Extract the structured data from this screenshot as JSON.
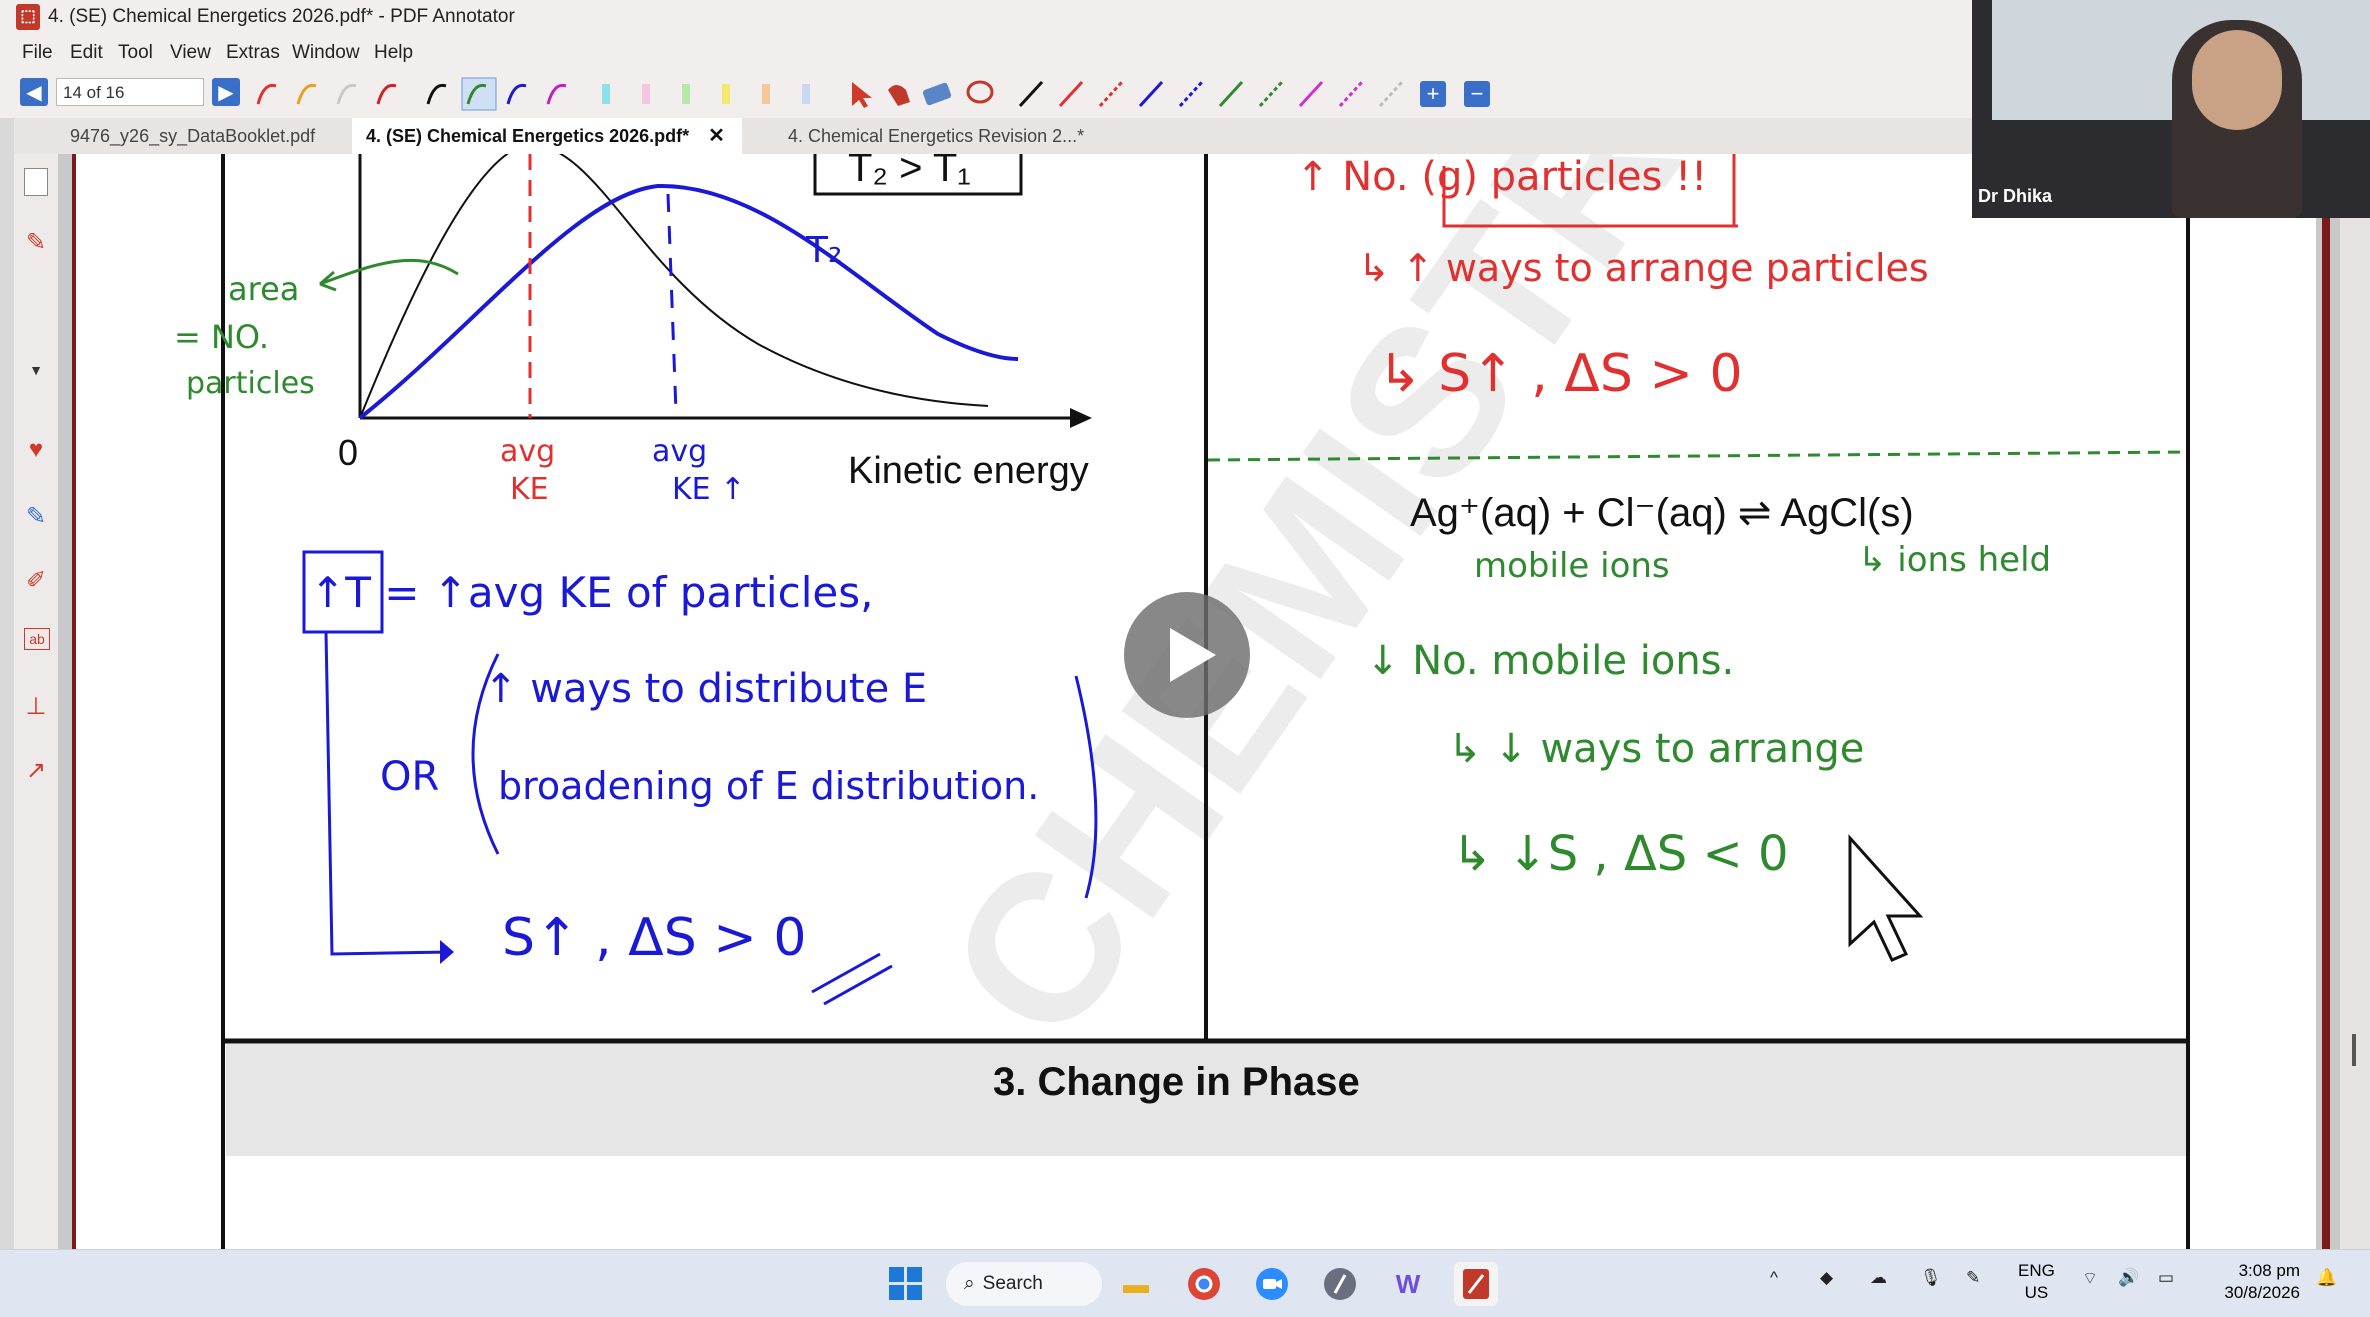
{
  "window": {
    "title": "4. (SE) Chemical Energetics 2026.pdf* - PDF Annotator",
    "app_icon": "pdf-annotator-icon"
  },
  "menu": [
    "File",
    "Edit",
    "Tool",
    "View",
    "Extras",
    "Window",
    "Help"
  ],
  "toolbar": {
    "page_indicator": "14 of 16",
    "prev_icon": "prev-page-icon",
    "next_icon": "next-page-icon"
  },
  "tabs": [
    {
      "label": "9476_y26_sy_DataBooklet.pdf",
      "active": false
    },
    {
      "label": "4. (SE) Chemical Energetics 2026.pdf*",
      "active": true,
      "close": "✕"
    },
    {
      "label": "4. Chemical Energetics Revision 2...*",
      "active": false
    }
  ],
  "document": {
    "box_label_partial": "T₂ > T₁",
    "origin_label": "0",
    "x_axis_label": "Kinetic energy",
    "curve_label": "T₂",
    "equation": "Ag⁺(aq) + Cl⁻(aq) ⇌ AgCl(s)",
    "section_heading": "3. Change in Phase"
  },
  "annotations": {
    "left_green": [
      "area",
      "= NO.",
      "particles"
    ],
    "left_red_peak": [
      "avg",
      "KE"
    ],
    "left_blue_peak": [
      "avg",
      "KE ↑"
    ],
    "left_blue_lines": [
      "↑T = ↑avg KE of particles,",
      "↑ ways to distribute E",
      "OR",
      "broadening of E distribution.",
      "S↑ , ΔS > 0"
    ],
    "right_red_lines": [
      "↑ No. (g) particles !!",
      "↳ ↑ ways to arrange particles",
      "↳ S↑ , ΔS > 0"
    ],
    "right_green_lines": [
      "mobile ions",
      "↳ ions held",
      "↓ No. mobile ions.",
      "↳ ↓ ways to arrange",
      "↳ ↓S , ΔS < 0"
    ]
  },
  "webcam": {
    "name": "Dr Dhika"
  },
  "taskbar": {
    "search_label": "Search",
    "lang_top": "ENG",
    "lang_bottom": "US",
    "time": "3:08 pm",
    "date": "30/8/2026",
    "apps": [
      "windows-start-icon",
      "file-explorer-icon",
      "chrome-icon",
      "zoom-icon",
      "app-icon",
      "word-icon",
      "pdf-annotator-taskbar-icon"
    ]
  },
  "colors": {
    "ink_red": "#e03030",
    "ink_blue": "#1a1ad6",
    "ink_green": "#2f8a2f",
    "heading_bg": "#e6e6e6",
    "margin_red": "#7a1a1a"
  }
}
